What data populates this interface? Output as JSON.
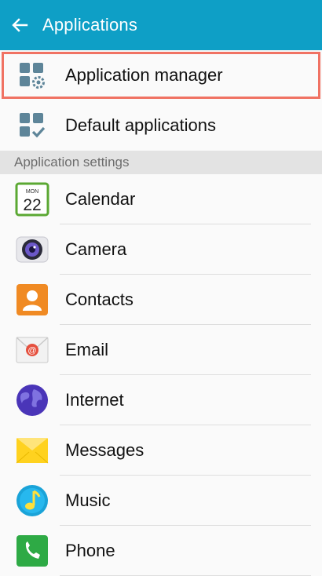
{
  "header": {
    "title": "Applications",
    "back_icon": "arrow-left-icon"
  },
  "top_items": [
    {
      "label": "Application manager",
      "icon": "app-manager-gear-icon",
      "highlighted": true
    },
    {
      "label": "Default applications",
      "icon": "default-apps-check-icon"
    }
  ],
  "section_header": "Application settings",
  "apps": [
    {
      "label": "Calendar",
      "icon": "calendar-icon",
      "icon_text_month": "MON",
      "icon_text_day": "22"
    },
    {
      "label": "Camera",
      "icon": "camera-icon"
    },
    {
      "label": "Contacts",
      "icon": "contacts-icon"
    },
    {
      "label": "Email",
      "icon": "email-icon"
    },
    {
      "label": "Internet",
      "icon": "internet-globe-icon"
    },
    {
      "label": "Messages",
      "icon": "messages-icon"
    },
    {
      "label": "Music",
      "icon": "music-icon"
    },
    {
      "label": "Phone",
      "icon": "phone-icon"
    }
  ],
  "colors": {
    "appbar": "#0e9fc6",
    "highlight_border": "#f07263",
    "section_bg": "#e3e3e3",
    "section_text": "#6d6d6d"
  }
}
